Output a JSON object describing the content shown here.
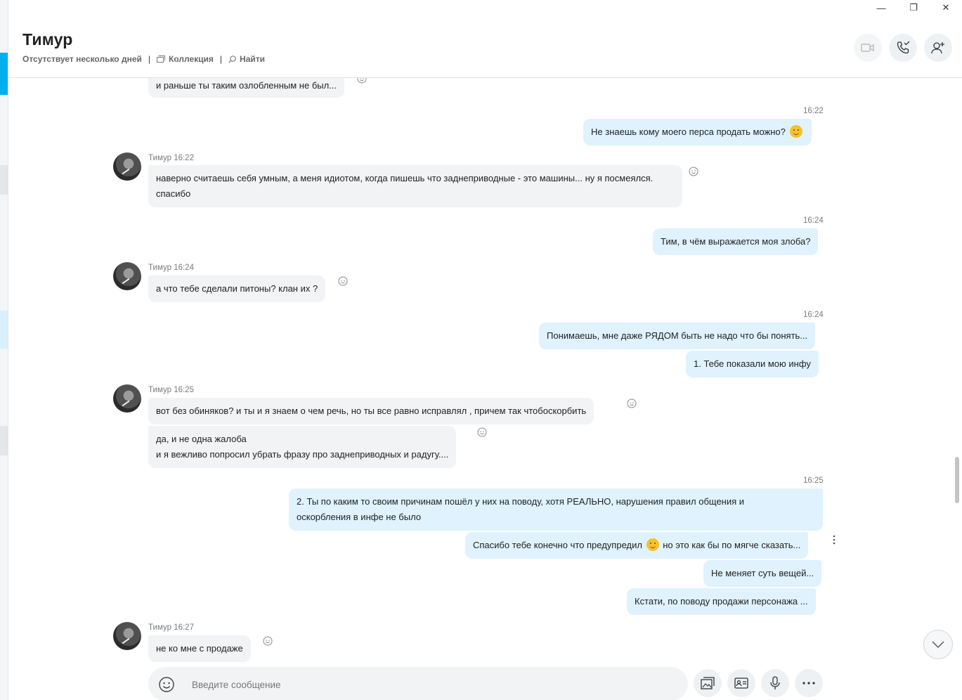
{
  "window": {
    "minimize": "—",
    "restore": "❐",
    "close": "✕"
  },
  "header": {
    "contact_name": "Тимур",
    "status": "Отсутствует несколько дней",
    "collection_label": "Коллекция",
    "find_label": "Найти",
    "separator": "|"
  },
  "colors": {
    "accent": "#00aff0",
    "outgoing_bubble": "#dff2fd",
    "incoming_bubble": "#f1f3f5"
  },
  "messages": {
    "m0": {
      "text": "и раньше ты таким озлобленным не был..."
    },
    "t1": "16:22",
    "m1": {
      "text": "Не знаешь кому моего перса продать можно?"
    },
    "h2": "Тимур 16:22",
    "m2": {
      "text": "наверно считаешь себя умным, а меня идиотом, когда пишешь что заднеприводные - это машины... ну я посмеялся.\nспасибо"
    },
    "t3": "16:24",
    "m3": {
      "text": "Тим, в чём выражается моя злоба?"
    },
    "h4": "Тимур 16:24",
    "m4": {
      "text": "а что тебе сделали питоны? клан их ?"
    },
    "t5": "16:24",
    "m5": {
      "text": "Понимаешь, мне даже РЯДОМ быть не надо что бы понять..."
    },
    "m6": {
      "text": "1. Тебе показали мою инфу"
    },
    "h7": "Тимур 16:25",
    "m7": {
      "text": "вот без обиняков? и ты   и я знаем о чем речь, но ты все равно исправлял , причем так чтобоскорбить"
    },
    "m8": {
      "text": "да, и не одна жалоба\nи я вежливо попросил убрать фразу про заднеприводных и радугу...."
    },
    "t9": "16:25",
    "m9": {
      "text": "2. Ты по каким то своим причинам пошёл у них на поводу, хотя РЕАЛЬНО, нарушения правил общения и\nоскорбления  в инфе не было"
    },
    "m10": {
      "text_before": "Спасибо тебе конечно что предупредил",
      "text_after": "но это как бы по мягче сказать..."
    },
    "m11": {
      "text": "Не меняет суть вещей..."
    },
    "m12": {
      "text": "Кстати, по поводу продажи персонажа ..."
    },
    "h13": "Тимур 16:27",
    "m13": {
      "text": "не ко мне с продаже"
    }
  },
  "composer": {
    "placeholder": "Введите сообщение"
  },
  "icons": [
    "video-call-icon",
    "audio-call-icon",
    "add-person-icon",
    "emoji-icon",
    "media-gallery-icon",
    "contact-card-icon",
    "microphone-icon",
    "more-icon",
    "scroll-down-icon",
    "message-options-icon"
  ]
}
